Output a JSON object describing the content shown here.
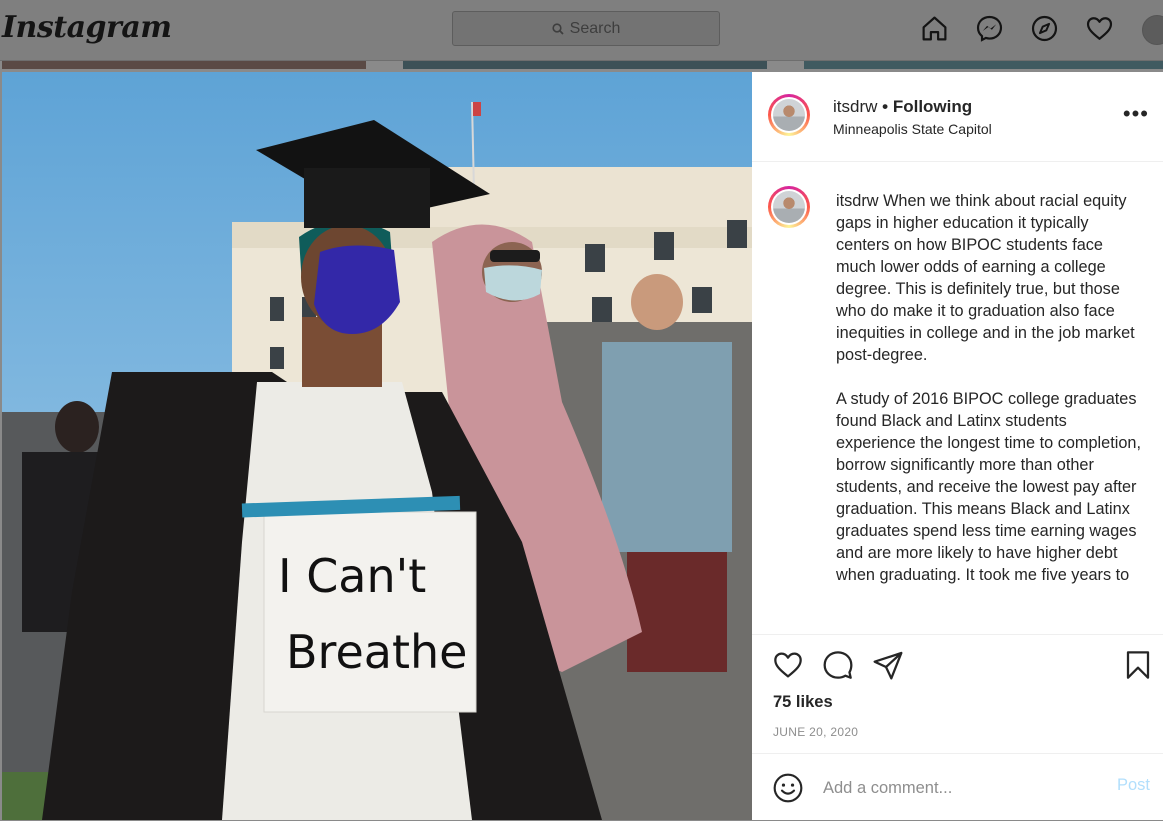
{
  "brand": {
    "logo_text": "Instagram"
  },
  "search": {
    "placeholder": "Search"
  },
  "nav": {
    "icons": [
      "home-icon",
      "messenger-icon",
      "explore-icon",
      "heart-icon",
      "profile-avatar"
    ]
  },
  "post": {
    "username": "itsdrw",
    "follow_status": "Following",
    "location": "Minneapolis State Capitol",
    "more_label": "•••",
    "photo_sign_text": [
      "I Can't",
      "Breathe"
    ],
    "caption_paragraphs": [
      "When we think about racial equity gaps in higher education it typically centers on how BIPOC students face much lower odds of earning a college degree. This is definitely true, but those who do make it to graduation also face inequities in college and in the job market post-degree.",
      "A study of 2016 BIPOC college graduates found Black and Latinx students experience the longest time to completion, borrow significantly more than other students, and receive the lowest pay after graduation. This means Black and Latinx graduates spend less time earning wages and are more likely to have higher debt when graduating. It took me five years to"
    ],
    "likes": "75 likes",
    "date": "JUNE 20, 2020",
    "comment_placeholder": "Add a comment...",
    "post_label": "Post"
  }
}
